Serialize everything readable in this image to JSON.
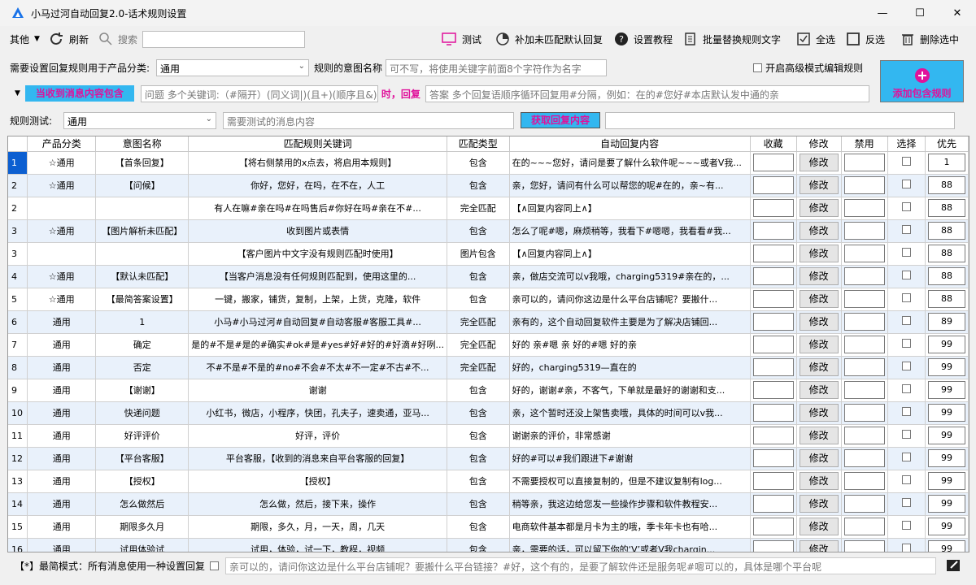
{
  "window": {
    "title": "小马过河自动回复2.0-话术规则设置"
  },
  "toolbar": {
    "other": "其他",
    "refresh": "刷新",
    "search_label": "搜索",
    "test": "测试",
    "fill_default": "补加未匹配默认回复",
    "tutorial": "设置教程",
    "batch_replace": "批量替换规则文字",
    "select_all": "全选",
    "invert": "反选",
    "delete_selected": "删除选中"
  },
  "rule_settings": {
    "category_label": "需要设置回复规则用于产品分类:",
    "category_value": "通用",
    "intent_label": "规则的意图名称",
    "intent_placeholder": "可不写，将使用关键字前面8个字符作为名字",
    "advanced_label": "开启高级模式编辑规则",
    "when_label": "当收到消息内容包含",
    "keywords_placeholder": "问题 多个关键词:（#隔开）(同义词|)(且+)(顺序且&)",
    "reply_label": "时，回复",
    "answer_placeholder": "答案 多个回复语顺序循环回复用#分隔，例如：在的#您好#本店默认发中通的亲",
    "add_button": "添加包含规则",
    "test_label": "规则测试:",
    "test_category": "通用",
    "test_placeholder": "需要测试的消息内容",
    "get_reply": "获取回复内容"
  },
  "table": {
    "headers": [
      "产品分类",
      "意图名称",
      "匹配规则关键词",
      "匹配类型",
      "自动回复内容",
      "收藏",
      "修改",
      "禁用",
      "选择",
      "优先"
    ],
    "edit_label": "修改",
    "rows": [
      {
        "idx": "1",
        "cat": "☆通用",
        "name": "【首条回复】",
        "kw": "【将右侧禁用的x点去，将启用本规则】",
        "type": "包含",
        "reply": "在的~~~您好，请问是要了解什么软件呢~~~或者V我...",
        "prio": "1"
      },
      {
        "idx": "2",
        "cat": "☆通用",
        "name": "【问候】",
        "kw": "你好，您好，在吗，在不在，人工",
        "type": "包含",
        "reply": "亲，您好，请问有什么可以帮您的呢#在的，亲~有...",
        "prio": "88"
      },
      {
        "idx": "2",
        "cat": "",
        "name": "",
        "kw": "有人在嘛#亲在吗#在吗售后#你好在吗#亲在不#...",
        "type": "完全匹配",
        "reply": "【∧回复内容同上∧】",
        "prio": "88"
      },
      {
        "idx": "3",
        "cat": "☆通用",
        "name": "【图片解析未匹配】",
        "kw": "收到图片或表情",
        "type": "包含",
        "reply": "怎么了呢#嗯，麻烦稍等，我看下#嗯嗯，我看看#我...",
        "prio": "88"
      },
      {
        "idx": "3",
        "cat": "",
        "name": "",
        "kw": "【客户图片中文字没有规则匹配时使用】",
        "type": "图片包含",
        "reply": "【∧回复内容同上∧】",
        "prio": "88"
      },
      {
        "idx": "4",
        "cat": "☆通用",
        "name": "【默认未匹配】",
        "kw": "【当客户消息没有任何规则匹配到，使用这里的...",
        "type": "包含",
        "reply": "亲，做店交流可以v我哦，charging5319#亲在的，...",
        "prio": "88"
      },
      {
        "idx": "5",
        "cat": "☆通用",
        "name": "【最简答案设置】",
        "kw": "一键，搬家，铺货，复制，上架，上货，克隆，软件",
        "type": "包含",
        "reply": "亲可以的，请问你这边是什么平台店铺呢？要搬什...",
        "prio": "88"
      },
      {
        "idx": "6",
        "cat": "通用",
        "name": "1",
        "kw": "小马#小马过河#自动回复#自动客服#客服工具#...",
        "type": "完全匹配",
        "reply": "亲有的，这个自动回复软件主要是为了解决店铺回...",
        "prio": "89"
      },
      {
        "idx": "7",
        "cat": "通用",
        "name": "确定",
        "kw": "是的#不是#是的#确实#ok#是#yes#好#好的#好滴#好咧...",
        "type": "完全匹配",
        "reply": "好的 亲#嗯 亲 好的#嗯 好的亲",
        "prio": "99"
      },
      {
        "idx": "8",
        "cat": "通用",
        "name": "否定",
        "kw": "不#不是#不是的#no#不会#不太#不一定#不古#不...",
        "type": "完全匹配",
        "reply": "好的，charging5319—直在的",
        "prio": "99"
      },
      {
        "idx": "9",
        "cat": "通用",
        "name": "【谢谢】",
        "kw": "谢谢",
        "type": "包含",
        "reply": "好的，谢谢#亲，不客气，下单就是最好的谢谢和支...",
        "prio": "99"
      },
      {
        "idx": "10",
        "cat": "通用",
        "name": "快递问题",
        "kw": "小红书，微店，小程序，快团，孔夫子，速卖通，亚马...",
        "type": "包含",
        "reply": "亲，这个暂时还没上架售卖哦，具体的时间可以v我...",
        "prio": "99"
      },
      {
        "idx": "11",
        "cat": "通用",
        "name": "好评评价",
        "kw": "好评，评价",
        "type": "包含",
        "reply": "谢谢亲的评价，非常感谢",
        "prio": "99"
      },
      {
        "idx": "12",
        "cat": "通用",
        "name": "【平台客服】",
        "kw": "平台客服，【收到的消息来自平台客服的回复】",
        "type": "包含",
        "reply": "好的#可以#我们跟进下#谢谢",
        "prio": "99"
      },
      {
        "idx": "13",
        "cat": "通用",
        "name": "【授权】",
        "kw": "【授权】",
        "type": "包含",
        "reply": "不需要授权可以直接复制的，但是不建议复制有log...",
        "prio": "99"
      },
      {
        "idx": "14",
        "cat": "通用",
        "name": "怎么做然后",
        "kw": "怎么做，然后，接下来，操作",
        "type": "包含",
        "reply": "稍等亲，我这边给您发一些操作步骤和软件教程安...",
        "prio": "99"
      },
      {
        "idx": "15",
        "cat": "通用",
        "name": "期限多久月",
        "kw": "期限，多久，月，一天，周，几天",
        "type": "包含",
        "reply": "电商软件基本都是月卡为主的哦，季卡年卡也有哈...",
        "prio": "99"
      },
      {
        "idx": "16",
        "cat": "通用",
        "name": "试用体验试",
        "kw": "试用，体验，试一下，教程，视频",
        "type": "包含",
        "reply": "亲，需要的话，可以留下你的‘V’或者V我chargin...",
        "prio": "99"
      }
    ]
  },
  "bottom": {
    "simple_mode": "【*】最简模式：所有消息使用一种设置回复",
    "simple_reply": "亲可以的，请问你这边是什么平台店铺呢？要搬什么平台链接？#好，这个有的，是要了解软件还是服务呢#嗯可以的，具体是哪个平台呢"
  },
  "colors": {
    "when_bg": "#33b7f0",
    "when_text": "#e0119b",
    "reply_label": "#e0119b",
    "add_bg": "#33b7f0",
    "add_text": "#e0119b",
    "get_reply_bg": "#33b7f0",
    "get_reply_text": "#e0119b",
    "selected_row": "#0c5fd1",
    "alt_row": "#e9f1fb"
  }
}
